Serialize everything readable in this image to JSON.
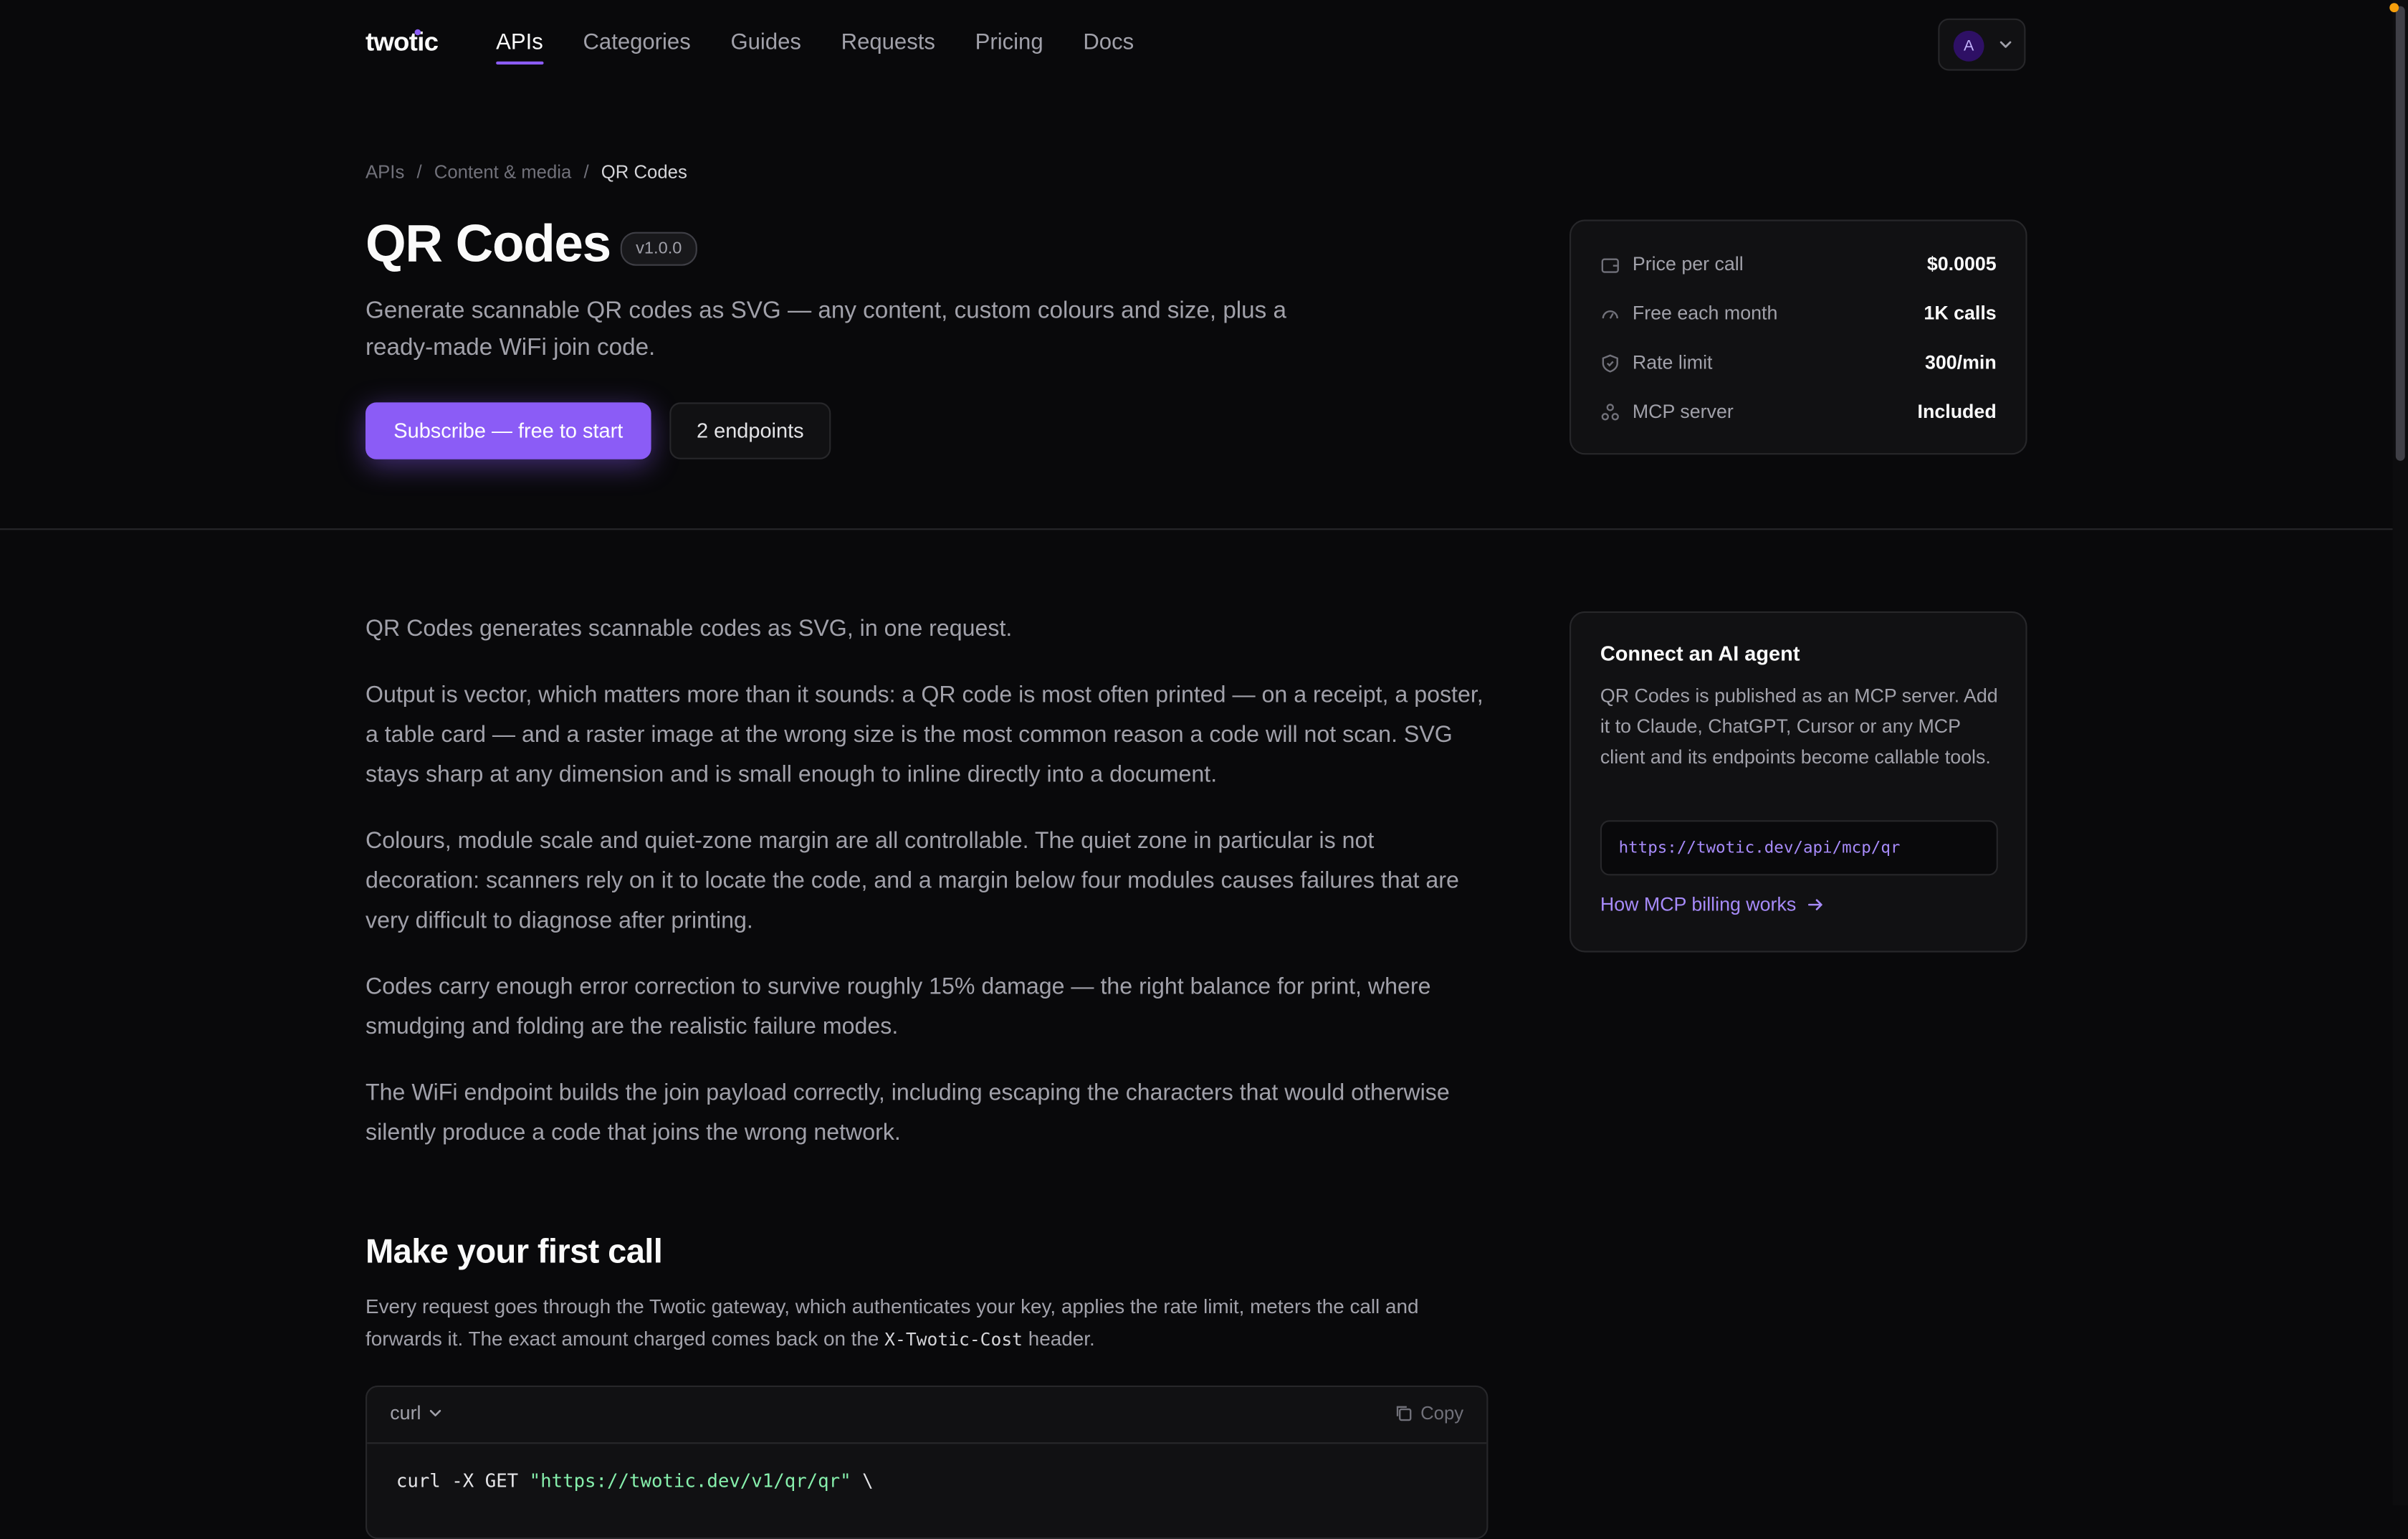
{
  "nav": {
    "logo": "twotic",
    "links": [
      "APIs",
      "Categories",
      "Guides",
      "Requests",
      "Pricing",
      "Docs"
    ],
    "active": "APIs",
    "account_initial": "A"
  },
  "breadcrumb": [
    "APIs",
    "Content & media",
    "QR Codes"
  ],
  "hero": {
    "title": "QR Codes",
    "version": "v1.0.0",
    "tagline": "Generate scannable QR codes as SVG — any content, custom colours and size, plus a ready-made WiFi join code.",
    "subscribe_label": "Subscribe — free to start",
    "endpoints_label": "2 endpoints"
  },
  "stats": [
    {
      "icon": "wallet-icon",
      "label": "Price per call",
      "value": "$0.0005"
    },
    {
      "icon": "gauge-icon",
      "label": "Free each month",
      "value": "1K calls"
    },
    {
      "icon": "shield-icon",
      "label": "Rate limit",
      "value": "300/min"
    },
    {
      "icon": "nodes-icon",
      "label": "MCP server",
      "value": "Included"
    }
  ],
  "body": [
    "QR Codes generates scannable codes as SVG, in one request.",
    "Output is vector, which matters more than it sounds: a QR code is most often printed — on a receipt, a poster, a table card — and a raster image at the wrong size is the most common reason a code will not scan. SVG stays sharp at any dimension and is small enough to inline directly into a document.",
    "Colours, module scale and quiet-zone margin are all controllable. The quiet zone in particular is not decoration: scanners rely on it to locate the code, and a margin below four modules causes failures that are very difficult to diagnose after printing.",
    "Codes carry enough error correction to survive roughly 15% damage — the right balance for print, where smudging and folding are the realistic failure modes.",
    "The WiFi endpoint builds the join payload correctly, including escaping the characters that would otherwise silently produce a code that joins the wrong network."
  ],
  "mcp": {
    "title": "Connect an AI agent",
    "text": "QR Codes is published as an MCP server. Add it to Claude, ChatGPT, Cursor or any MCP client and its endpoints become callable tools.",
    "url": "https://twotic.dev/api/mcp/qr",
    "link": "How MCP billing works"
  },
  "first_call": {
    "heading": "Make your first call",
    "text_before": "Every request goes through the Twotic gateway, which authenticates your key, applies the rate limit, meters the call and forwards it. The exact amount charged comes back on the ",
    "header_name": "X-Twotic-Cost",
    "text_after": " header.",
    "lang": "curl",
    "copy": "Copy",
    "code_cmd": "curl -X GET ",
    "code_url": "\"https://twotic.dev/v1/qr/qr\"",
    "code_cont": " \\"
  },
  "colors": {
    "accent": "#8b5cf6",
    "background": "#09090b",
    "card": "#111113"
  }
}
